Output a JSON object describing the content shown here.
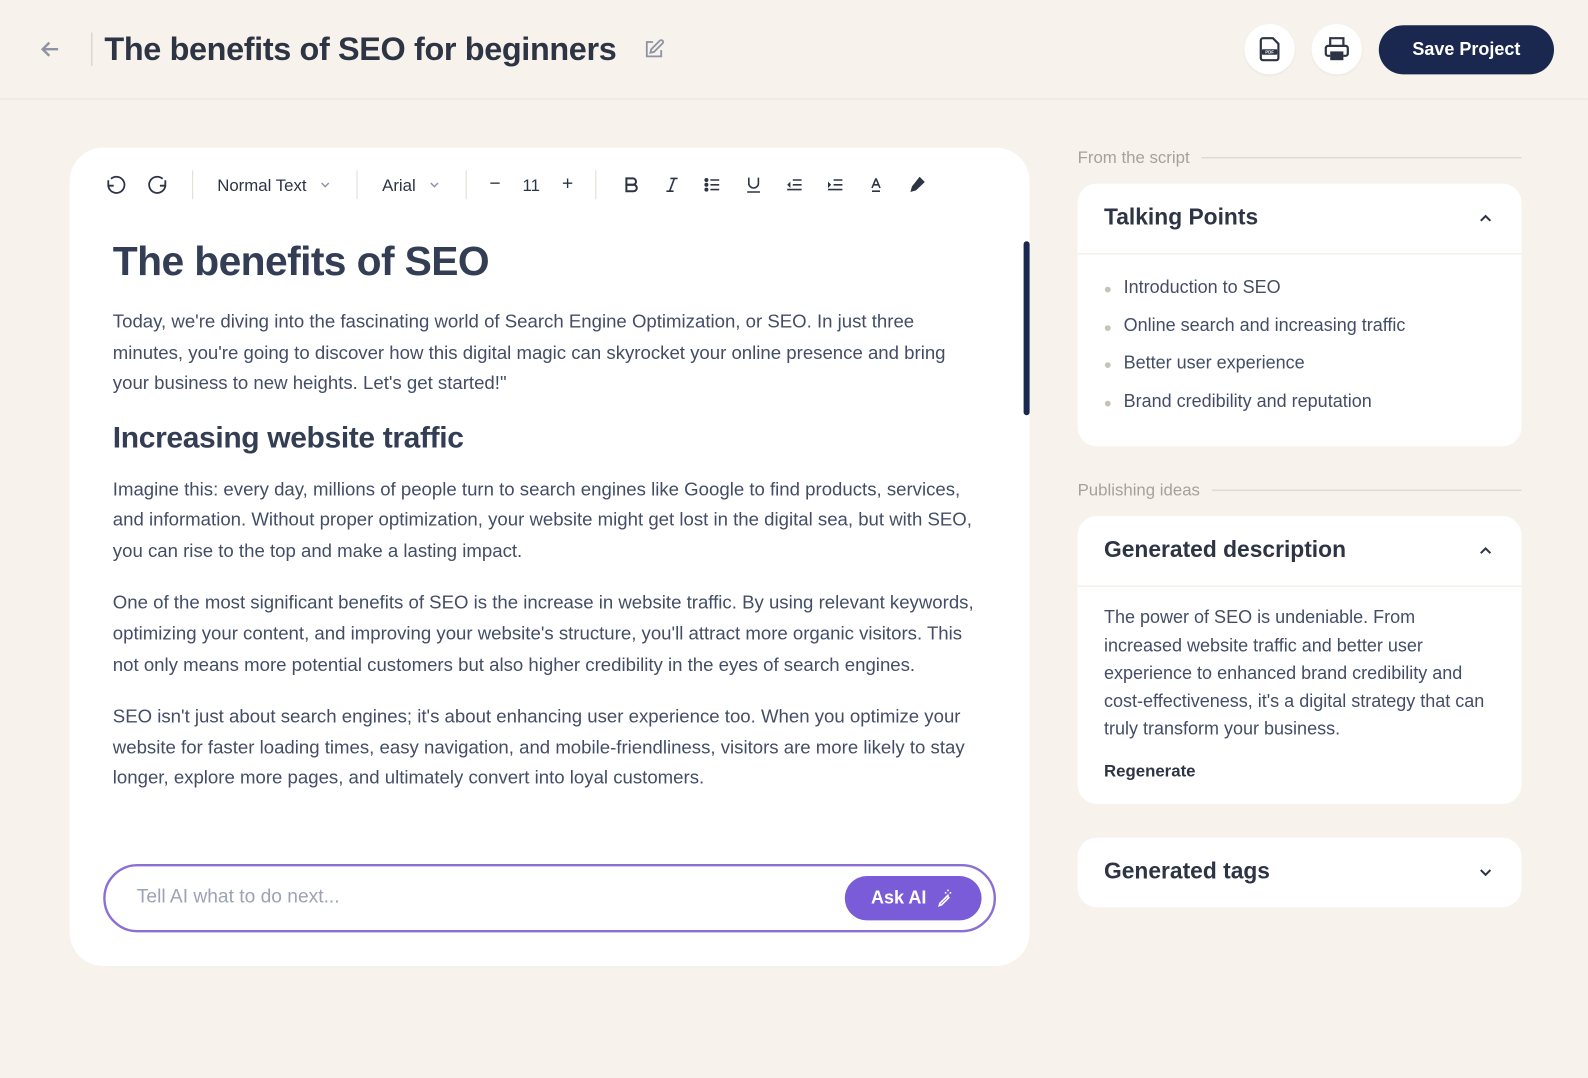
{
  "header": {
    "title": "The benefits of SEO for beginners",
    "save_label": "Save Project"
  },
  "toolbar": {
    "style_select": "Normal Text",
    "font_select": "Arial",
    "font_size": "11"
  },
  "document": {
    "h1": "The benefits of SEO",
    "p1": "Today, we're diving into the fascinating world of Search Engine Optimization, or SEO. In just three minutes, you're going to discover how this digital magic can skyrocket your online presence and bring your business to new heights. Let's get started!\"",
    "h2": "Increasing website traffic",
    "p2": "Imagine this: every day, millions of people turn to search engines like Google to find products, services, and information. Without proper optimization, your website might get lost in the digital sea, but with SEO, you can rise to the top and make a lasting impact.",
    "p3": "One of the most significant benefits of SEO is the increase in website traffic. By using relevant keywords, optimizing your content, and improving your website's structure, you'll attract more organic visitors. This not only means more potential customers but also higher credibility in the eyes of search engines.",
    "p4": "SEO isn't just about search engines; it's about enhancing user experience too. When you optimize your website for faster loading times, easy navigation, and mobile-friendliness, visitors are more likely to stay longer, explore more pages, and ultimately convert into loyal customers."
  },
  "ai": {
    "placeholder": "Tell AI what to do next...",
    "ask_label": "Ask AI"
  },
  "sidebar": {
    "script_label": "From the script",
    "publishing_label": "Publishing ideas",
    "talking_points": {
      "title": "Talking Points",
      "items": [
        "Introduction to SEO",
        "Online search and increasing traffic",
        "Better user experience",
        "Brand credibility and reputation"
      ]
    },
    "description": {
      "title": "Generated description",
      "text": "The power of SEO is undeniable. From increased website traffic and better user experience to enhanced brand credibility and cost-effectiveness, it's a digital strategy that can truly transform your business.",
      "regenerate_label": "Regenerate"
    },
    "tags": {
      "title": "Generated tags"
    }
  }
}
